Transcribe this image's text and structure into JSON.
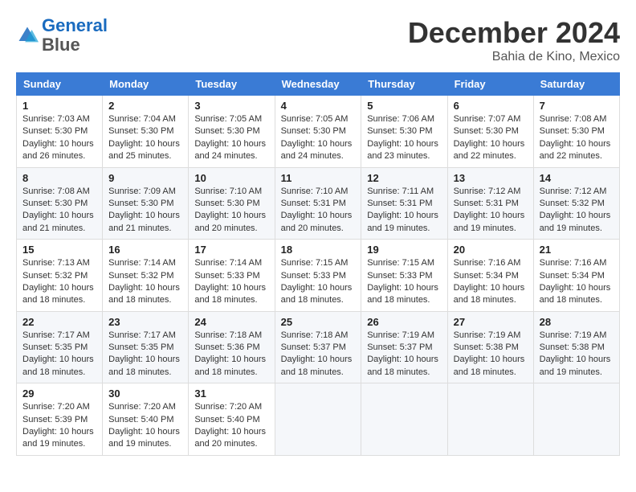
{
  "header": {
    "logo_line1": "General",
    "logo_line2": "Blue",
    "month_title": "December 2024",
    "location": "Bahia de Kino, Mexico"
  },
  "weekdays": [
    "Sunday",
    "Monday",
    "Tuesday",
    "Wednesday",
    "Thursday",
    "Friday",
    "Saturday"
  ],
  "weeks": [
    [
      {
        "day": "1",
        "sunrise": "7:03 AM",
        "sunset": "5:30 PM",
        "daylight": "10 hours and 26 minutes."
      },
      {
        "day": "2",
        "sunrise": "7:04 AM",
        "sunset": "5:30 PM",
        "daylight": "10 hours and 25 minutes."
      },
      {
        "day": "3",
        "sunrise": "7:05 AM",
        "sunset": "5:30 PM",
        "daylight": "10 hours and 24 minutes."
      },
      {
        "day": "4",
        "sunrise": "7:05 AM",
        "sunset": "5:30 PM",
        "daylight": "10 hours and 24 minutes."
      },
      {
        "day": "5",
        "sunrise": "7:06 AM",
        "sunset": "5:30 PM",
        "daylight": "10 hours and 23 minutes."
      },
      {
        "day": "6",
        "sunrise": "7:07 AM",
        "sunset": "5:30 PM",
        "daylight": "10 hours and 22 minutes."
      },
      {
        "day": "7",
        "sunrise": "7:08 AM",
        "sunset": "5:30 PM",
        "daylight": "10 hours and 22 minutes."
      }
    ],
    [
      {
        "day": "8",
        "sunrise": "7:08 AM",
        "sunset": "5:30 PM",
        "daylight": "10 hours and 21 minutes."
      },
      {
        "day": "9",
        "sunrise": "7:09 AM",
        "sunset": "5:30 PM",
        "daylight": "10 hours and 21 minutes."
      },
      {
        "day": "10",
        "sunrise": "7:10 AM",
        "sunset": "5:30 PM",
        "daylight": "10 hours and 20 minutes."
      },
      {
        "day": "11",
        "sunrise": "7:10 AM",
        "sunset": "5:31 PM",
        "daylight": "10 hours and 20 minutes."
      },
      {
        "day": "12",
        "sunrise": "7:11 AM",
        "sunset": "5:31 PM",
        "daylight": "10 hours and 19 minutes."
      },
      {
        "day": "13",
        "sunrise": "7:12 AM",
        "sunset": "5:31 PM",
        "daylight": "10 hours and 19 minutes."
      },
      {
        "day": "14",
        "sunrise": "7:12 AM",
        "sunset": "5:32 PM",
        "daylight": "10 hours and 19 minutes."
      }
    ],
    [
      {
        "day": "15",
        "sunrise": "7:13 AM",
        "sunset": "5:32 PM",
        "daylight": "10 hours and 18 minutes."
      },
      {
        "day": "16",
        "sunrise": "7:14 AM",
        "sunset": "5:32 PM",
        "daylight": "10 hours and 18 minutes."
      },
      {
        "day": "17",
        "sunrise": "7:14 AM",
        "sunset": "5:33 PM",
        "daylight": "10 hours and 18 minutes."
      },
      {
        "day": "18",
        "sunrise": "7:15 AM",
        "sunset": "5:33 PM",
        "daylight": "10 hours and 18 minutes."
      },
      {
        "day": "19",
        "sunrise": "7:15 AM",
        "sunset": "5:33 PM",
        "daylight": "10 hours and 18 minutes."
      },
      {
        "day": "20",
        "sunrise": "7:16 AM",
        "sunset": "5:34 PM",
        "daylight": "10 hours and 18 minutes."
      },
      {
        "day": "21",
        "sunrise": "7:16 AM",
        "sunset": "5:34 PM",
        "daylight": "10 hours and 18 minutes."
      }
    ],
    [
      {
        "day": "22",
        "sunrise": "7:17 AM",
        "sunset": "5:35 PM",
        "daylight": "10 hours and 18 minutes."
      },
      {
        "day": "23",
        "sunrise": "7:17 AM",
        "sunset": "5:35 PM",
        "daylight": "10 hours and 18 minutes."
      },
      {
        "day": "24",
        "sunrise": "7:18 AM",
        "sunset": "5:36 PM",
        "daylight": "10 hours and 18 minutes."
      },
      {
        "day": "25",
        "sunrise": "7:18 AM",
        "sunset": "5:37 PM",
        "daylight": "10 hours and 18 minutes."
      },
      {
        "day": "26",
        "sunrise": "7:19 AM",
        "sunset": "5:37 PM",
        "daylight": "10 hours and 18 minutes."
      },
      {
        "day": "27",
        "sunrise": "7:19 AM",
        "sunset": "5:38 PM",
        "daylight": "10 hours and 18 minutes."
      },
      {
        "day": "28",
        "sunrise": "7:19 AM",
        "sunset": "5:38 PM",
        "daylight": "10 hours and 19 minutes."
      }
    ],
    [
      {
        "day": "29",
        "sunrise": "7:20 AM",
        "sunset": "5:39 PM",
        "daylight": "10 hours and 19 minutes."
      },
      {
        "day": "30",
        "sunrise": "7:20 AM",
        "sunset": "5:40 PM",
        "daylight": "10 hours and 19 minutes."
      },
      {
        "day": "31",
        "sunrise": "7:20 AM",
        "sunset": "5:40 PM",
        "daylight": "10 hours and 20 minutes."
      },
      null,
      null,
      null,
      null
    ]
  ]
}
